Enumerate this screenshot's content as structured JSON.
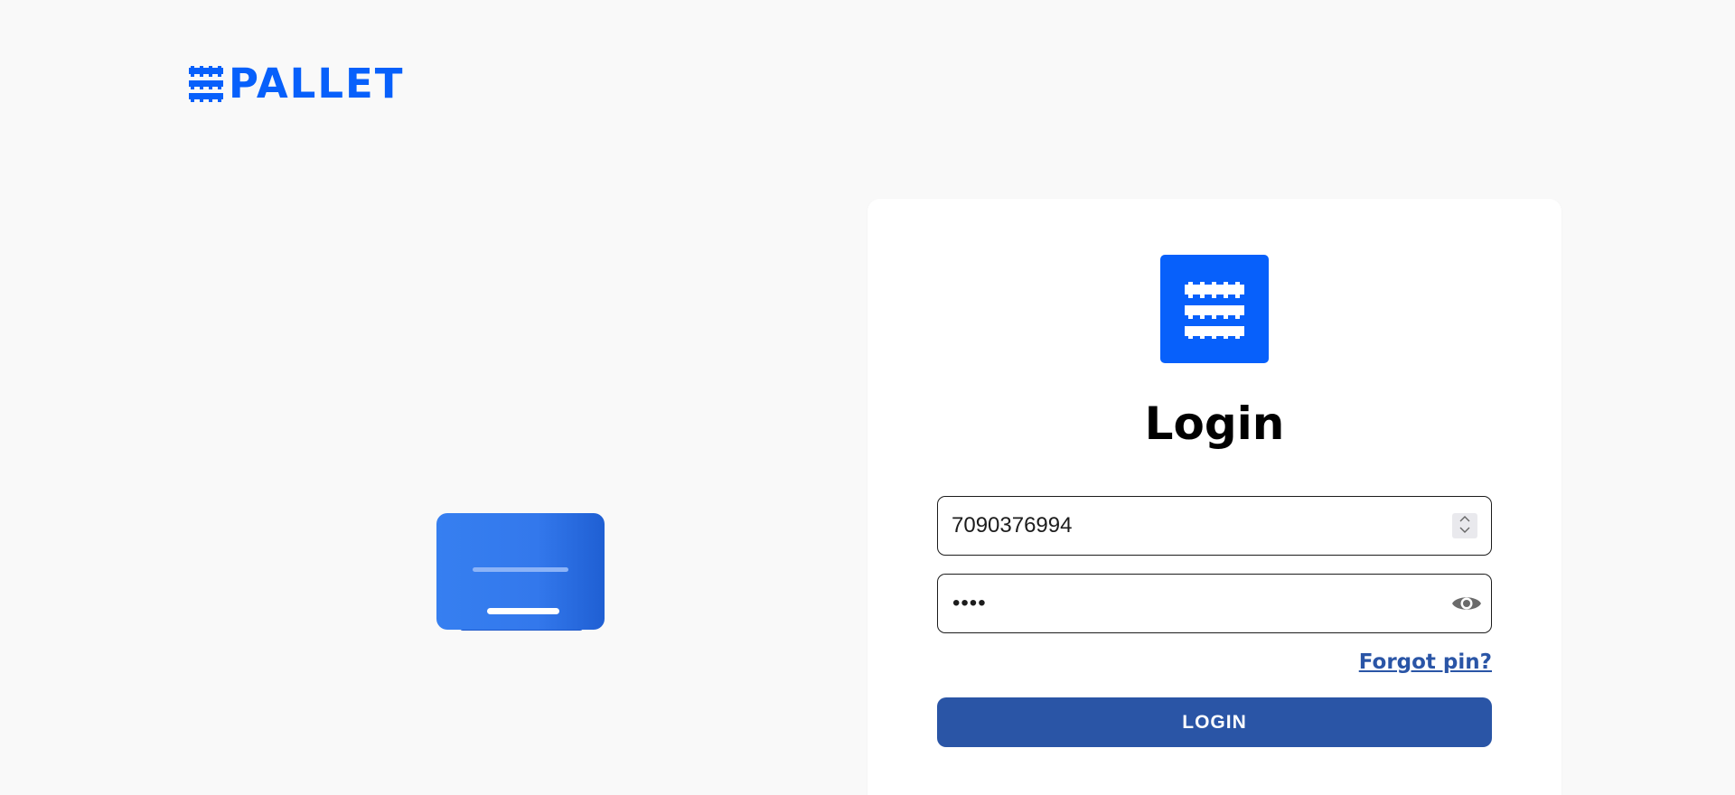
{
  "brand": {
    "name": "PALLET",
    "color": "#0760fb"
  },
  "illustration": {
    "icon": "payment-card-illustration"
  },
  "login_card": {
    "app_icon": "pallet-icon",
    "title": "Login",
    "phone_field": {
      "value": "7090376994",
      "stepper_icon": "number-stepper-icon"
    },
    "pin_field": {
      "masked_value": "••••",
      "visibility_icon": "eye-icon"
    },
    "forgot_link": "Forgot pin?",
    "login_button": "LOGIN"
  },
  "colors": {
    "accent": "#0760fb",
    "button": "#2a55a6",
    "link": "#2a55a6",
    "background": "#f9f9f9",
    "card": "#ffffff"
  }
}
